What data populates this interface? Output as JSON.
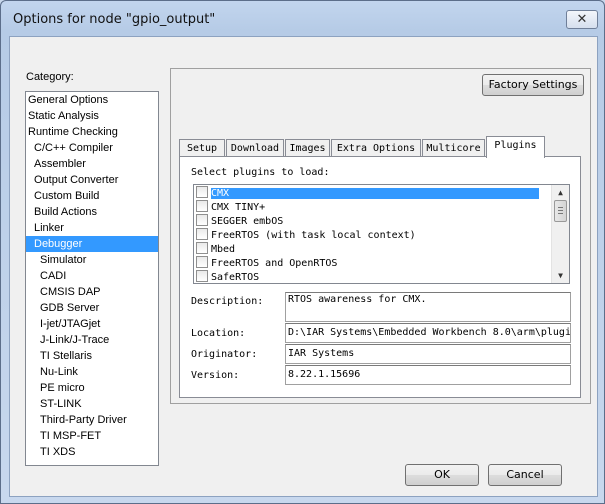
{
  "window": {
    "title": "Options for node \"gpio_output\"",
    "close_glyph": "✕"
  },
  "category": {
    "label": "Category:",
    "items": [
      {
        "label": "General Options",
        "level": 0
      },
      {
        "label": "Static Analysis",
        "level": 0
      },
      {
        "label": "Runtime Checking",
        "level": 0
      },
      {
        "label": "C/C++ Compiler",
        "level": 1
      },
      {
        "label": "Assembler",
        "level": 1
      },
      {
        "label": "Output Converter",
        "level": 1
      },
      {
        "label": "Custom Build",
        "level": 1
      },
      {
        "label": "Build Actions",
        "level": 1
      },
      {
        "label": "Linker",
        "level": 1
      },
      {
        "label": "Debugger",
        "level": 1,
        "selected": true
      },
      {
        "label": "Simulator",
        "level": 2
      },
      {
        "label": "CADI",
        "level": 2
      },
      {
        "label": "CMSIS DAP",
        "level": 2
      },
      {
        "label": "GDB Server",
        "level": 2
      },
      {
        "label": "I-jet/JTAGjet",
        "level": 2
      },
      {
        "label": "J-Link/J-Trace",
        "level": 2
      },
      {
        "label": "TI Stellaris",
        "level": 2
      },
      {
        "label": "Nu-Link",
        "level": 2
      },
      {
        "label": "PE micro",
        "level": 2
      },
      {
        "label": "ST-LINK",
        "level": 2
      },
      {
        "label": "Third-Party Driver",
        "level": 2
      },
      {
        "label": "TI MSP-FET",
        "level": 2
      },
      {
        "label": "TI XDS",
        "level": 2
      }
    ]
  },
  "factory_settings_label": "Factory Settings",
  "tabs": [
    "Setup",
    "Download",
    "Images",
    "Extra Options",
    "Multicore",
    "Plugins"
  ],
  "active_tab": "Plugins",
  "plugins": {
    "select_label": "Select plugins to load:",
    "items": [
      {
        "label": "CMX",
        "selected": true
      },
      {
        "label": "CMX TINY+"
      },
      {
        "label": "SEGGER embOS"
      },
      {
        "label": "FreeRTOS (with task local context)"
      },
      {
        "label": "Mbed"
      },
      {
        "label": "FreeRTOS and OpenRTOS"
      },
      {
        "label": "SafeRTOS"
      }
    ]
  },
  "details": {
    "description_label": "Description:",
    "description_value": "RTOS awareness for CMX.",
    "location_label": "Location:",
    "location_value": "D:\\IAR Systems\\Embedded Workbench 8.0\\arm\\plugi",
    "originator_label": "Originator:",
    "originator_value": "IAR Systems",
    "version_label": "Version:",
    "version_value": "8.22.1.15696"
  },
  "buttons": {
    "ok": "OK",
    "cancel": "Cancel"
  }
}
